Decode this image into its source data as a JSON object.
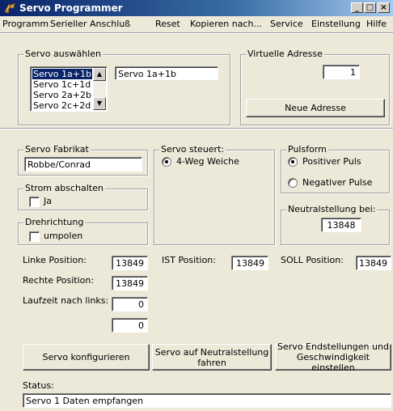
{
  "window": {
    "title": "Servo Programmer",
    "min": "_",
    "max": "□",
    "close": "×"
  },
  "menu": [
    "Programm",
    "Serieller Anschluß",
    "Reset",
    "Kopieren nach...",
    "Service",
    "Einstellung",
    "Hilfe"
  ],
  "servo_select": {
    "legend": "Servo auswählen",
    "items": [
      "Servo 1a+1b",
      "Servo 1c+1d",
      "Servo 2a+2b",
      "Servo 2c+2d"
    ],
    "selected_index": 0,
    "name_value": "Servo 1a+1b"
  },
  "virtual": {
    "legend": "Virtuelle Adresse",
    "value": "1",
    "button": "Neue Adresse"
  },
  "fabrikat": {
    "legend": "Servo Fabrikat",
    "value": "Robbe/Conrad"
  },
  "strom": {
    "legend": "Strom abschalten",
    "checkbox": "Ja"
  },
  "drehrichtung": {
    "legend": "Drehrichtung",
    "checkbox": "umpolen"
  },
  "steuert": {
    "legend": "Servo steuert:",
    "option": "4-Weg Weiche"
  },
  "pulsform": {
    "legend": "Pulsform",
    "opt1": "Positiver Puls",
    "opt2": "Negativer Pulse"
  },
  "neutral": {
    "legend": "Neutralstellung bei:",
    "value": "13848"
  },
  "positions": {
    "linke_label": "Linke Position:",
    "linke_value": "13849",
    "rechte_label": "Rechte Position:",
    "rechte_value": "13849",
    "lauf_label": "Laufzeit nach links:",
    "lauf_value": "0",
    "extra_value": "0",
    "ist_label": "IST Position:",
    "ist_value": "13849",
    "soll_label": "SOLL Position:",
    "soll_value": "13849"
  },
  "buttons": {
    "konfig": "Servo konfigurieren",
    "neutral_l1": "Servo auf Neutralstellung",
    "neutral_l2": "fahren",
    "end_l1": "Servo Endstellungen und",
    "end_l2": "Geschwindigkeit einstellen"
  },
  "status": {
    "label": "Status:",
    "value": "Servo 1 Daten empfangen"
  }
}
